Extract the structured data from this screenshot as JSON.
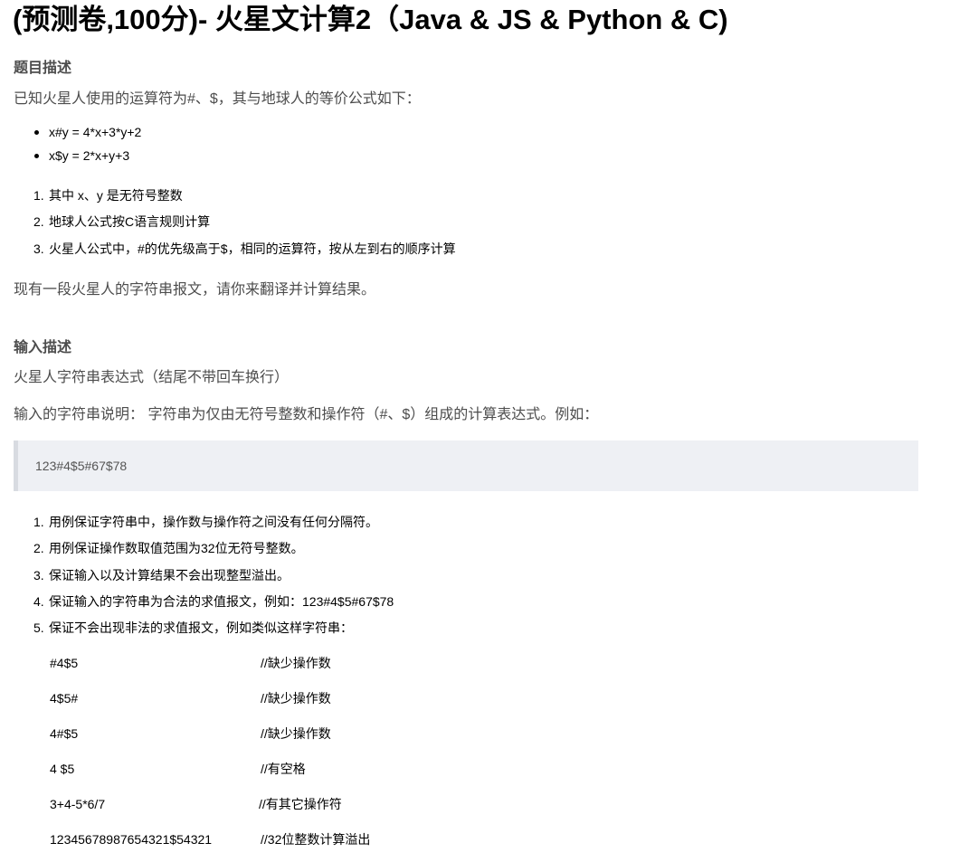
{
  "title": "(预测卷,100分)- 火星文计算2（Java & JS & Python & C)",
  "description": {
    "heading": "题目描述",
    "intro": "已知火星人使用的运算符为#、$，其与地球人的等价公式如下：",
    "formulas": [
      "x#y = 4*x+3*y+2",
      "x$y = 2*x+y+3"
    ],
    "rules": [
      {
        "num": "1.",
        "text": "其中 x、y 是无符号整数"
      },
      {
        "num": "2.",
        "text": "地球人公式按C语言规则计算"
      },
      {
        "num": "3.",
        "text": "火星人公式中，#的优先级高于$，相同的运算符，按从左到右的顺序计算"
      }
    ],
    "task": "现有一段火星人的字符串报文，请你来翻译并计算结果。"
  },
  "input": {
    "heading": "输入描述",
    "line1": "火星人字符串表达式（结尾不带回车换行）",
    "line2": "输入的字符串说明：  字符串为仅由无符号整数和操作符（#、$）组成的计算表达式。例如：",
    "example": "123#4$5#67$78",
    "notes": [
      {
        "num": "1.",
        "text": "用例保证字符串中，操作数与操作符之间没有任何分隔符。"
      },
      {
        "num": "2.",
        "text": "用例保证操作数取值范围为32位无符号整数。"
      },
      {
        "num": "3.",
        "text": "保证输入以及计算结果不会出现整型溢出。"
      },
      {
        "num": "4.",
        "text": "保证输入的字符串为合法的求值报文，例如：123#4$5#67$78"
      },
      {
        "num": "5.",
        "text": "保证不会出现非法的求值报文，例如类似这样字符串："
      }
    ],
    "invalid_examples": [
      {
        "expr": "#4$5",
        "note": "//缺少操作数"
      },
      {
        "expr": "4$5#",
        "note": "//缺少操作数"
      },
      {
        "expr": "4#$5",
        "note": "//缺少操作数"
      },
      {
        "expr": "4 $5",
        "note": "//有空格"
      },
      {
        "expr": "3+4-5*6/7",
        "note": "//有其它操作符"
      },
      {
        "expr": "12345678987654321$54321",
        "note": "//32位整数计算溢出"
      }
    ]
  }
}
